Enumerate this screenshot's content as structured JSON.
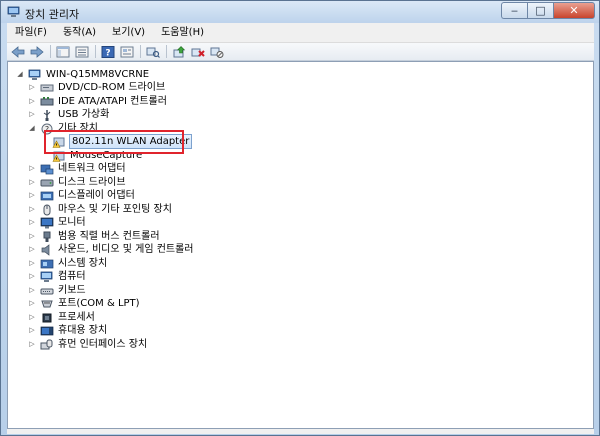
{
  "window": {
    "title": "장치 관리자",
    "controls": [
      "minimize",
      "maximize",
      "close"
    ]
  },
  "menu": [
    "파일(F)",
    "동작(A)",
    "보기(V)",
    "도움말(H)"
  ],
  "toolbar": {
    "buttons": [
      "back-icon",
      "forward-icon",
      "show-hide-icon",
      "properties-icon",
      "help-icon",
      "action-icon",
      "scan-icon",
      "update-driver-icon",
      "uninstall-icon",
      "disable-icon"
    ]
  },
  "tree": {
    "root": "WIN-Q15MM8VCRNE",
    "categories": [
      {
        "label": "DVD/CD-ROM 드라이브",
        "icon": "dvd-drive-icon"
      },
      {
        "label": "IDE ATA/ATAPI 컨트롤러",
        "icon": "ide-controller-icon"
      },
      {
        "label": "USB 가상화",
        "icon": "usb-icon"
      },
      {
        "label": "기타 장치",
        "icon": "other-devices-icon",
        "expanded": true
      },
      {
        "label": "네트워크 어댑터",
        "icon": "network-adapter-icon"
      },
      {
        "label": "디스크 드라이브",
        "icon": "disk-drive-icon"
      },
      {
        "label": "디스플레이 어댑터",
        "icon": "display-adapter-icon"
      },
      {
        "label": "마우스 및 기타 포인팅 장치",
        "icon": "mouse-icon"
      },
      {
        "label": "모니터",
        "icon": "monitor-icon"
      },
      {
        "label": "범용 직렬 버스 컨트롤러",
        "icon": "usb-controller-icon"
      },
      {
        "label": "사운드, 비디오 및 게임 컨트롤러",
        "icon": "sound-icon"
      },
      {
        "label": "시스템 장치",
        "icon": "system-devices-icon"
      },
      {
        "label": "컴퓨터",
        "icon": "computer-icon"
      },
      {
        "label": "키보드",
        "icon": "keyboard-icon"
      },
      {
        "label": "포트(COM & LPT)",
        "icon": "port-icon"
      },
      {
        "label": "프로세서",
        "icon": "processor-icon"
      },
      {
        "label": "휴대용 장치",
        "icon": "portable-device-icon"
      },
      {
        "label": "휴먼 인터페이스 장치",
        "icon": "hid-icon"
      }
    ],
    "other_devices_children": [
      {
        "label": "802.11n WLAN Adapter",
        "icon": "warning-device-icon",
        "selected": true
      },
      {
        "label": "MouseCapture",
        "icon": "warning-device-icon"
      }
    ]
  },
  "colors": {
    "highlight_box": "#e0242c",
    "selection": "#cfe3fa",
    "title_bar": "#bdd3ec"
  }
}
